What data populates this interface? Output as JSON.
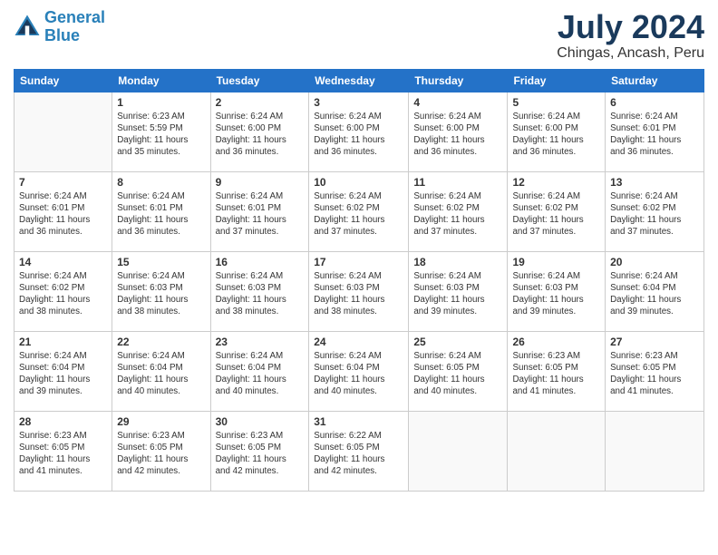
{
  "logo": {
    "line1": "General",
    "line2": "Blue"
  },
  "title": {
    "month_year": "July 2024",
    "location": "Chingas, Ancash, Peru"
  },
  "days_of_week": [
    "Sunday",
    "Monday",
    "Tuesday",
    "Wednesday",
    "Thursday",
    "Friday",
    "Saturday"
  ],
  "weeks": [
    [
      {
        "day": "",
        "detail": ""
      },
      {
        "day": "1",
        "detail": "Sunrise: 6:23 AM\nSunset: 5:59 PM\nDaylight: 11 hours\nand 35 minutes."
      },
      {
        "day": "2",
        "detail": "Sunrise: 6:24 AM\nSunset: 6:00 PM\nDaylight: 11 hours\nand 36 minutes."
      },
      {
        "day": "3",
        "detail": "Sunrise: 6:24 AM\nSunset: 6:00 PM\nDaylight: 11 hours\nand 36 minutes."
      },
      {
        "day": "4",
        "detail": "Sunrise: 6:24 AM\nSunset: 6:00 PM\nDaylight: 11 hours\nand 36 minutes."
      },
      {
        "day": "5",
        "detail": "Sunrise: 6:24 AM\nSunset: 6:00 PM\nDaylight: 11 hours\nand 36 minutes."
      },
      {
        "day": "6",
        "detail": "Sunrise: 6:24 AM\nSunset: 6:01 PM\nDaylight: 11 hours\nand 36 minutes."
      }
    ],
    [
      {
        "day": "7",
        "detail": "Sunrise: 6:24 AM\nSunset: 6:01 PM\nDaylight: 11 hours\nand 36 minutes."
      },
      {
        "day": "8",
        "detail": "Sunrise: 6:24 AM\nSunset: 6:01 PM\nDaylight: 11 hours\nand 36 minutes."
      },
      {
        "day": "9",
        "detail": "Sunrise: 6:24 AM\nSunset: 6:01 PM\nDaylight: 11 hours\nand 37 minutes."
      },
      {
        "day": "10",
        "detail": "Sunrise: 6:24 AM\nSunset: 6:02 PM\nDaylight: 11 hours\nand 37 minutes."
      },
      {
        "day": "11",
        "detail": "Sunrise: 6:24 AM\nSunset: 6:02 PM\nDaylight: 11 hours\nand 37 minutes."
      },
      {
        "day": "12",
        "detail": "Sunrise: 6:24 AM\nSunset: 6:02 PM\nDaylight: 11 hours\nand 37 minutes."
      },
      {
        "day": "13",
        "detail": "Sunrise: 6:24 AM\nSunset: 6:02 PM\nDaylight: 11 hours\nand 37 minutes."
      }
    ],
    [
      {
        "day": "14",
        "detail": "Sunrise: 6:24 AM\nSunset: 6:02 PM\nDaylight: 11 hours\nand 38 minutes."
      },
      {
        "day": "15",
        "detail": "Sunrise: 6:24 AM\nSunset: 6:03 PM\nDaylight: 11 hours\nand 38 minutes."
      },
      {
        "day": "16",
        "detail": "Sunrise: 6:24 AM\nSunset: 6:03 PM\nDaylight: 11 hours\nand 38 minutes."
      },
      {
        "day": "17",
        "detail": "Sunrise: 6:24 AM\nSunset: 6:03 PM\nDaylight: 11 hours\nand 38 minutes."
      },
      {
        "day": "18",
        "detail": "Sunrise: 6:24 AM\nSunset: 6:03 PM\nDaylight: 11 hours\nand 39 minutes."
      },
      {
        "day": "19",
        "detail": "Sunrise: 6:24 AM\nSunset: 6:03 PM\nDaylight: 11 hours\nand 39 minutes."
      },
      {
        "day": "20",
        "detail": "Sunrise: 6:24 AM\nSunset: 6:04 PM\nDaylight: 11 hours\nand 39 minutes."
      }
    ],
    [
      {
        "day": "21",
        "detail": "Sunrise: 6:24 AM\nSunset: 6:04 PM\nDaylight: 11 hours\nand 39 minutes."
      },
      {
        "day": "22",
        "detail": "Sunrise: 6:24 AM\nSunset: 6:04 PM\nDaylight: 11 hours\nand 40 minutes."
      },
      {
        "day": "23",
        "detail": "Sunrise: 6:24 AM\nSunset: 6:04 PM\nDaylight: 11 hours\nand 40 minutes."
      },
      {
        "day": "24",
        "detail": "Sunrise: 6:24 AM\nSunset: 6:04 PM\nDaylight: 11 hours\nand 40 minutes."
      },
      {
        "day": "25",
        "detail": "Sunrise: 6:24 AM\nSunset: 6:05 PM\nDaylight: 11 hours\nand 40 minutes."
      },
      {
        "day": "26",
        "detail": "Sunrise: 6:23 AM\nSunset: 6:05 PM\nDaylight: 11 hours\nand 41 minutes."
      },
      {
        "day": "27",
        "detail": "Sunrise: 6:23 AM\nSunset: 6:05 PM\nDaylight: 11 hours\nand 41 minutes."
      }
    ],
    [
      {
        "day": "28",
        "detail": "Sunrise: 6:23 AM\nSunset: 6:05 PM\nDaylight: 11 hours\nand 41 minutes."
      },
      {
        "day": "29",
        "detail": "Sunrise: 6:23 AM\nSunset: 6:05 PM\nDaylight: 11 hours\nand 42 minutes."
      },
      {
        "day": "30",
        "detail": "Sunrise: 6:23 AM\nSunset: 6:05 PM\nDaylight: 11 hours\nand 42 minutes."
      },
      {
        "day": "31",
        "detail": "Sunrise: 6:22 AM\nSunset: 6:05 PM\nDaylight: 11 hours\nand 42 minutes."
      },
      {
        "day": "",
        "detail": ""
      },
      {
        "day": "",
        "detail": ""
      },
      {
        "day": "",
        "detail": ""
      }
    ]
  ]
}
